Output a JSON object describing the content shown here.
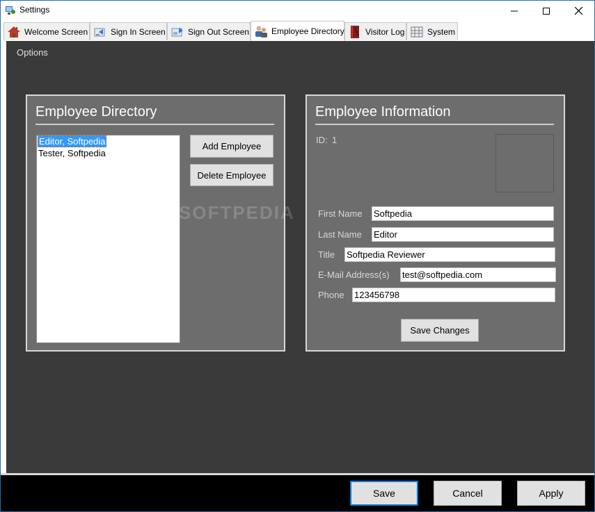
{
  "window": {
    "title": "Settings",
    "controls": {
      "minimize": "—",
      "maximize": "☐",
      "close": "✕"
    }
  },
  "tabs": [
    {
      "label": "Welcome Screen",
      "icon": "house-icon"
    },
    {
      "label": "Sign In Screen",
      "icon": "sign-in-icon"
    },
    {
      "label": "Sign Out Screen",
      "icon": "sign-out-icon"
    },
    {
      "label": "Employee Directory",
      "icon": "people-icon",
      "active": true
    },
    {
      "label": "Visitor Log",
      "icon": "book-icon"
    },
    {
      "label": "System",
      "icon": "network-icon"
    }
  ],
  "options_label": "Options",
  "directory": {
    "title": "Employee Directory",
    "employees": [
      "Editor, Softpedia",
      "Tester, Softpedia"
    ],
    "selected_index": 0,
    "add_button": "Add Employee",
    "delete_button": "Delete Employee"
  },
  "watermark": "SOFTPEDIA",
  "info": {
    "title": "Employee Information",
    "id_label": "ID:",
    "id_value": "1",
    "first_name_label": "First Name",
    "first_name": "Softpedia",
    "last_name_label": "Last Name",
    "last_name": "Editor",
    "title_label": "Title",
    "job_title": "Softpedia Reviewer",
    "email_label": "E-Mail Address(s)",
    "email": "test@softpedia.com",
    "phone_label": "Phone",
    "phone": "123456798",
    "save_changes_button": "Save Changes"
  },
  "dialog_buttons": {
    "save": "Save",
    "cancel": "Cancel",
    "apply": "Apply"
  },
  "colors": {
    "panel_bg": "#6d6d6d",
    "content_bg": "#3a3a3a",
    "selection": "#3399ff",
    "accent": "#0078d7"
  }
}
